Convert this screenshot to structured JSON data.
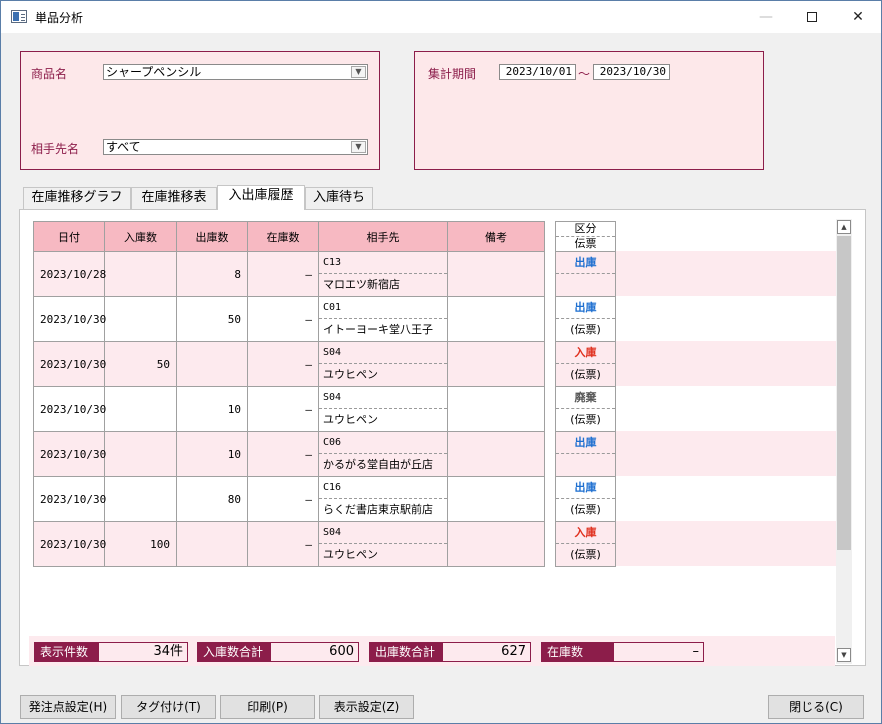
{
  "window": {
    "title": "単品分析"
  },
  "filter": {
    "product_label": "商品名",
    "product_value": "シャープペンシル",
    "partner_label": "相手先名",
    "partner_value": "すべて",
    "period_label": "集計期間",
    "date_from": "2023/10/01",
    "date_sep": "～",
    "date_to": "2023/10/30"
  },
  "tabs": [
    "在庫推移グラフ",
    "在庫推移表",
    "入出庫履歴",
    "入庫待ち"
  ],
  "grid": {
    "headers": [
      "日付",
      "入庫数",
      "出庫数",
      "在庫数",
      "相手先",
      "備考"
    ],
    "kubun_header": [
      "区分",
      "伝票"
    ],
    "rows": [
      {
        "date": "2023/10/28",
        "in": "",
        "out": "8",
        "stock": "–",
        "code": "C13",
        "name": "マロエツ新宿店",
        "note": "",
        "kubun": "出庫",
        "slip": ""
      },
      {
        "date": "2023/10/30",
        "in": "",
        "out": "50",
        "stock": "–",
        "code": "C01",
        "name": "イトーヨーキ堂八王子",
        "note": "",
        "kubun": "出庫",
        "slip": "(伝票)"
      },
      {
        "date": "2023/10/30",
        "in": "50",
        "out": "",
        "stock": "–",
        "code": "S04",
        "name": "ユウヒペン",
        "note": "",
        "kubun": "入庫",
        "slip": "(伝票)"
      },
      {
        "date": "2023/10/30",
        "in": "",
        "out": "10",
        "stock": "–",
        "code": "S04",
        "name": "ユウヒペン",
        "note": "",
        "kubun": "廃棄",
        "slip": "(伝票)"
      },
      {
        "date": "2023/10/30",
        "in": "",
        "out": "10",
        "stock": "–",
        "code": "C06",
        "name": "かるがる堂自由が丘店",
        "note": "",
        "kubun": "出庫",
        "slip": ""
      },
      {
        "date": "2023/10/30",
        "in": "",
        "out": "80",
        "stock": "–",
        "code": "C16",
        "name": "らくだ書店東京駅前店",
        "note": "",
        "kubun": "出庫",
        "slip": "(伝票)"
      },
      {
        "date": "2023/10/30",
        "in": "100",
        "out": "",
        "stock": "–",
        "code": "S04",
        "name": "ユウヒペン",
        "note": "",
        "kubun": "入庫",
        "slip": "(伝票)"
      }
    ]
  },
  "kubun_colors": {
    "出庫": "#1e6fd0",
    "入庫": "#e0301e",
    "廃棄": "#555555"
  },
  "summary": {
    "count_label": "表示件数",
    "count_value": "34件",
    "in_total_label": "入庫数合計",
    "in_total_value": "600",
    "out_total_label": "出庫数合計",
    "out_total_value": "627",
    "stock_label": "在庫数",
    "stock_value": "–"
  },
  "buttons": {
    "order_point": "発注点設定(H)",
    "tag": "タグ付け(T)",
    "print": "印刷(P)",
    "display": "表示設定(Z)",
    "close": "閉じる(C)"
  }
}
